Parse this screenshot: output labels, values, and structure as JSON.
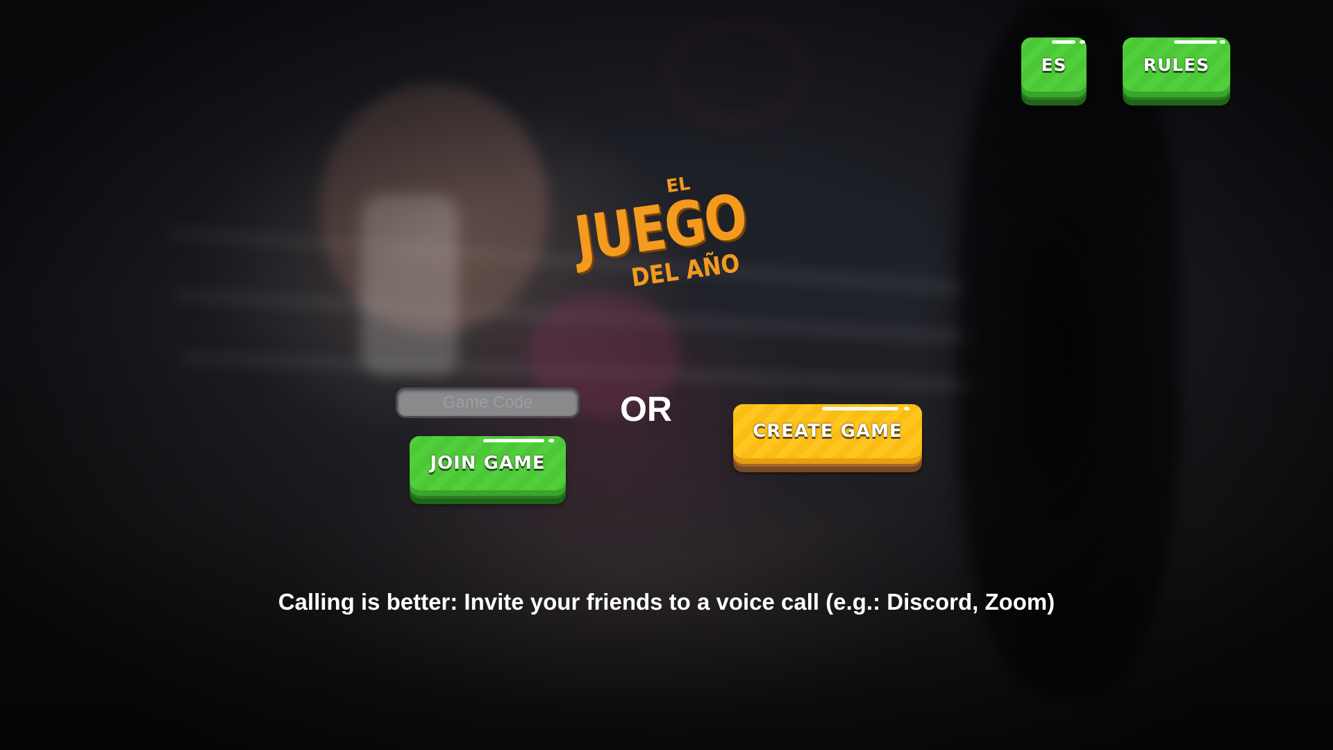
{
  "header": {
    "language_button_label": "ES",
    "rules_button_label": "RULES"
  },
  "logo": {
    "line1": "EL",
    "line2": "JUEGO",
    "line3": "DEL AÑO"
  },
  "join": {
    "code_placeholder": "Game Code",
    "join_button_label": "JOIN GAME"
  },
  "divider_label": "OR",
  "create": {
    "create_button_label": "CREATE GAME"
  },
  "tagline": "Calling is better: Invite your friends to a voice call (e.g.: Discord, Zoom)",
  "colors": {
    "accent_green": "#4cc736",
    "accent_yellow": "#f9bd14",
    "logo_orange": "#f39a1f"
  }
}
